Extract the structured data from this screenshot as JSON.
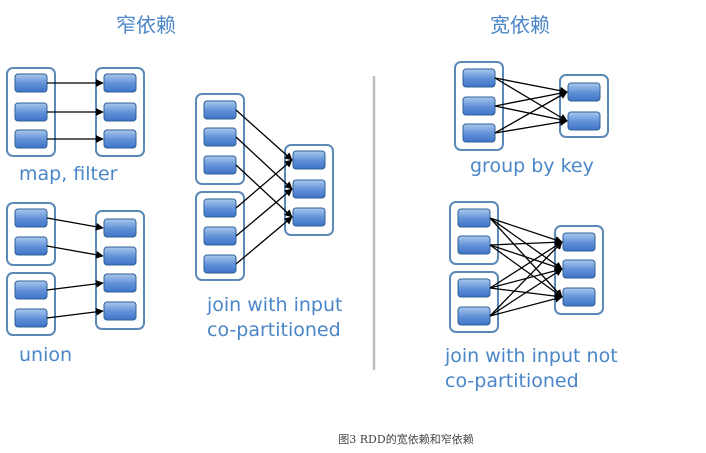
{
  "sections": {
    "narrow_title": "窄依赖",
    "wide_title": "宽依赖"
  },
  "labels": {
    "map_filter": "map, filter",
    "union": "union",
    "join_copart_line1": "join with input",
    "join_copart_line2": "co-partitioned",
    "group_by_key": "group by key",
    "join_not_copart_line1": "join with input not",
    "join_not_copart_line2": "co-partitioned"
  },
  "caption": "图3  RDD的宽依赖和窄依赖",
  "colors": {
    "text": "#4a86c8",
    "partition_fill_top": "#a9c8ee",
    "partition_fill_bottom": "#3f74c8",
    "container_stroke": "#5b89b8",
    "divider": "#c0c0c0",
    "edge": "#000000"
  }
}
